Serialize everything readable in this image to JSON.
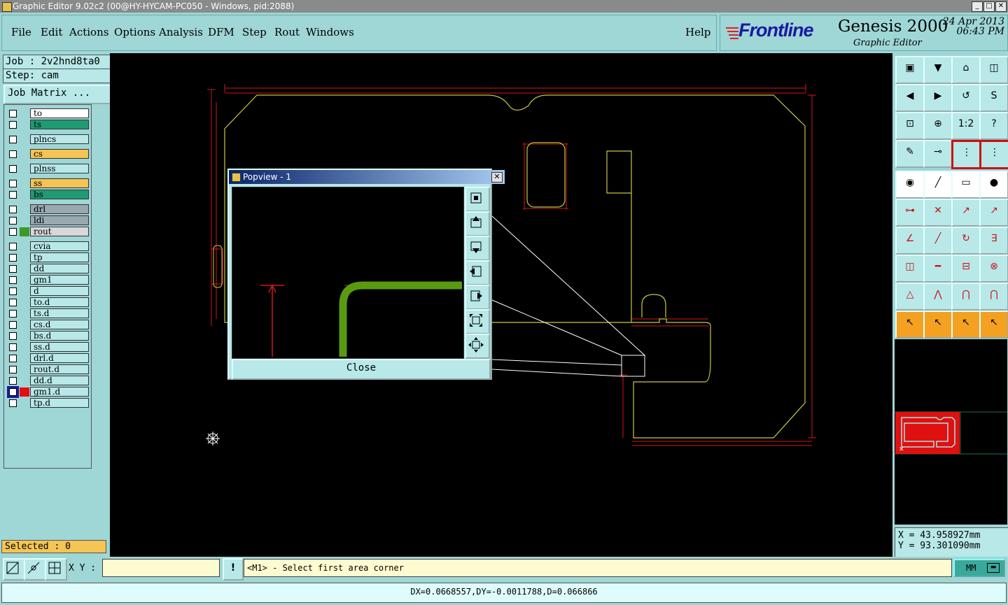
{
  "window": {
    "title": "Graphic Editor 9.02c2 (00@HY-HYCAM-PC050 - Windows, pid:2088)",
    "min": "_",
    "max": "□",
    "close": "✕"
  },
  "menu": [
    {
      "label": "File"
    },
    {
      "label": "Edit"
    },
    {
      "label": "Actions"
    },
    {
      "label": "Options"
    },
    {
      "label": "Analysis"
    },
    {
      "label": "DFM"
    },
    {
      "label": "Step"
    },
    {
      "label": "Rout"
    },
    {
      "label": "Windows"
    },
    {
      "label": "Help"
    }
  ],
  "branding": {
    "logo": "Frontline",
    "product": "Genesis 2000",
    "subtitle": "Graphic Editor",
    "date": "24 Apr 2013",
    "time": "06:43 PM"
  },
  "job": {
    "job_line": "Job : 2v2hnd8ta0",
    "step_line": "Step: cam",
    "matrix_label": "Job Matrix ..."
  },
  "layers": [
    {
      "name": "to",
      "bg": "#ffffff",
      "color": ""
    },
    {
      "name": "ts",
      "bg": "#1f9a72",
      "color": ""
    },
    {
      "name": "plncs",
      "bg": "#b8e8e8",
      "color": ""
    },
    {
      "name": "cs",
      "bg": "#f4c454",
      "color": ""
    },
    {
      "name": "plnss",
      "bg": "#b8e8e8",
      "color": ""
    },
    {
      "name": "ss",
      "bg": "#f4c454",
      "color": ""
    },
    {
      "name": "bs",
      "bg": "#1f9a72",
      "color": ""
    },
    {
      "name": "drl",
      "bg": "#9aa8b0",
      "color": ""
    },
    {
      "name": "ldi",
      "bg": "#9aa8b0",
      "color": ""
    },
    {
      "name": "rout",
      "bg": "#d8d8d8",
      "color": "#3a9a2a"
    },
    {
      "name": "cvia",
      "bg": "#b8e8e8",
      "color": ""
    },
    {
      "name": "tp",
      "bg": "#b8e8e8",
      "color": ""
    },
    {
      "name": "dd",
      "bg": "#b8e8e8",
      "color": ""
    },
    {
      "name": "gm1",
      "bg": "#b8e8e8",
      "color": ""
    },
    {
      "name": "d",
      "bg": "#b8e8e8",
      "color": ""
    },
    {
      "name": "to.d",
      "bg": "#b8e8e8",
      "color": ""
    },
    {
      "name": "ts.d",
      "bg": "#b8e8e8",
      "color": ""
    },
    {
      "name": "cs.d",
      "bg": "#b8e8e8",
      "color": ""
    },
    {
      "name": "bs.d",
      "bg": "#b8e8e8",
      "color": ""
    },
    {
      "name": "ss.d",
      "bg": "#b8e8e8",
      "color": ""
    },
    {
      "name": "drl.d",
      "bg": "#b8e8e8",
      "color": ""
    },
    {
      "name": "rout.d",
      "bg": "#b8e8e8",
      "color": ""
    },
    {
      "name": "dd.d",
      "bg": "#b8e8e8",
      "color": ""
    },
    {
      "name": "gm1.d",
      "bg": "#b8e8e8",
      "color": "#e01010",
      "active": true
    },
    {
      "name": "tp.d",
      "bg": "#b8e8e8",
      "color": ""
    }
  ],
  "selected": "Selected : 0",
  "popview": {
    "title": "Popview - 1",
    "close_label": "Close"
  },
  "coords": {
    "x": "X = 43.958927mm",
    "y": "Y = 93.301090mm"
  },
  "bottom": {
    "xy_label": "X Y :",
    "xy_value": "",
    "prompt": "<M1> - Select first area corner",
    "unit": "MM",
    "excl": "!"
  },
  "status": "DX=0.0668557,DY=-0.0011788,D=0.066866",
  "colors": {
    "outline": "#c8c840",
    "dimension": "#d01818",
    "rout_path": "#5a9a10"
  }
}
